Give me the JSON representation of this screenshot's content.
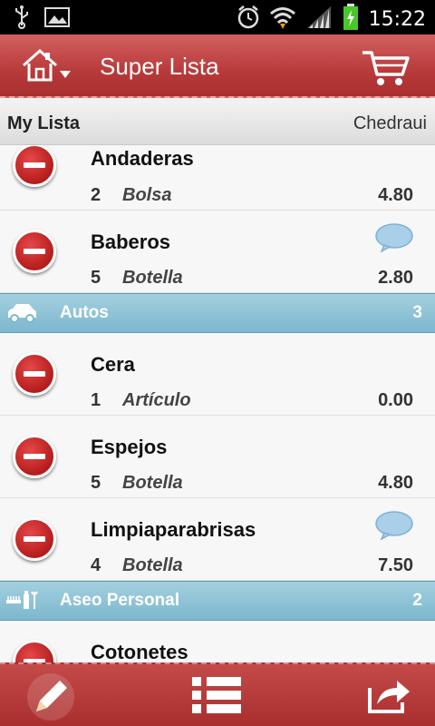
{
  "status_bar": {
    "time": "15:22"
  },
  "header": {
    "title": "Super Lista"
  },
  "subheader": {
    "list_name": "My Lista",
    "store": "Chedraui"
  },
  "items_top": [
    {
      "name": "Andaderas",
      "qty": "2",
      "unit": "Bolsa",
      "price": "4.80"
    },
    {
      "name": "Baberos",
      "qty": "5",
      "unit": "Botella",
      "price": "2.80",
      "has_comment": true
    }
  ],
  "category_autos": {
    "name": "Autos",
    "count": "3"
  },
  "items_autos": [
    {
      "name": "Cera",
      "qty": "1",
      "unit": "Artículo",
      "price": "0.00"
    },
    {
      "name": "Espejos",
      "qty": "5",
      "unit": "Botella",
      "price": "4.80"
    },
    {
      "name": "Limpiaparabrisas",
      "qty": "4",
      "unit": "Botella",
      "price": "7.50",
      "has_comment": true
    }
  ],
  "category_aseo": {
    "name": "Aseo Personal",
    "count": "2"
  },
  "items_aseo": [
    {
      "name": "Cotonetes"
    }
  ],
  "colors": {
    "header_red": "#b83a3a",
    "category_blue": "#8cc2d6"
  }
}
